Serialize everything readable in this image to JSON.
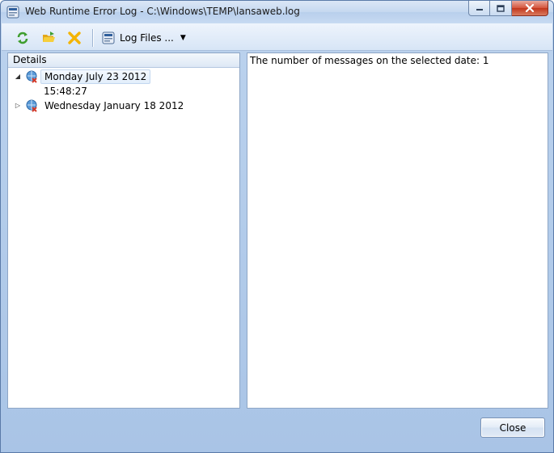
{
  "window": {
    "title": "Web Runtime Error Log - C:\\Windows\\TEMP\\lansaweb.log"
  },
  "toolbar": {
    "refresh_icon": "refresh-icon",
    "open_icon": "open-folder-icon",
    "delete_icon": "delete-x-icon",
    "log_files_label": "Log Files ..."
  },
  "tree": {
    "header": "Details",
    "items": [
      {
        "label": "Monday July 23 2012",
        "expanded": true,
        "selected": true
      },
      {
        "label": "15:48:27"
      },
      {
        "label": "Wednesday January 18 2012",
        "expanded": false
      }
    ]
  },
  "details": {
    "message": "The number of messages on the selected date: 1"
  },
  "footer": {
    "close_label": "Close"
  },
  "colors": {
    "refresh": "#3f9e2f",
    "folder": "#f2c22c",
    "delete": "#f4b400",
    "close_caption": "#c9402a"
  }
}
